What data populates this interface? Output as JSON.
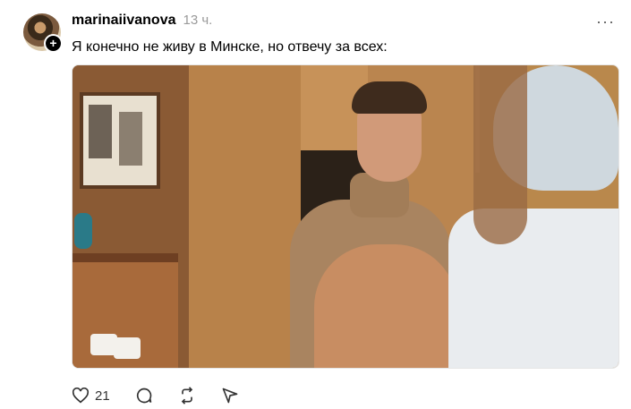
{
  "post": {
    "username": "marinaiivanova",
    "time": "13 ч.",
    "text": "Я конечно не живу в Минске, но отвечу за всех:",
    "more_label": "···"
  },
  "avatar": {
    "plus": "+"
  },
  "actions": {
    "likes_count": "21",
    "icons": [
      "heart-icon",
      "comment-icon",
      "repost-icon",
      "share-icon"
    ]
  },
  "colors": {
    "text": "#000000",
    "muted": "#9a9a9a",
    "icon": "#333333"
  }
}
